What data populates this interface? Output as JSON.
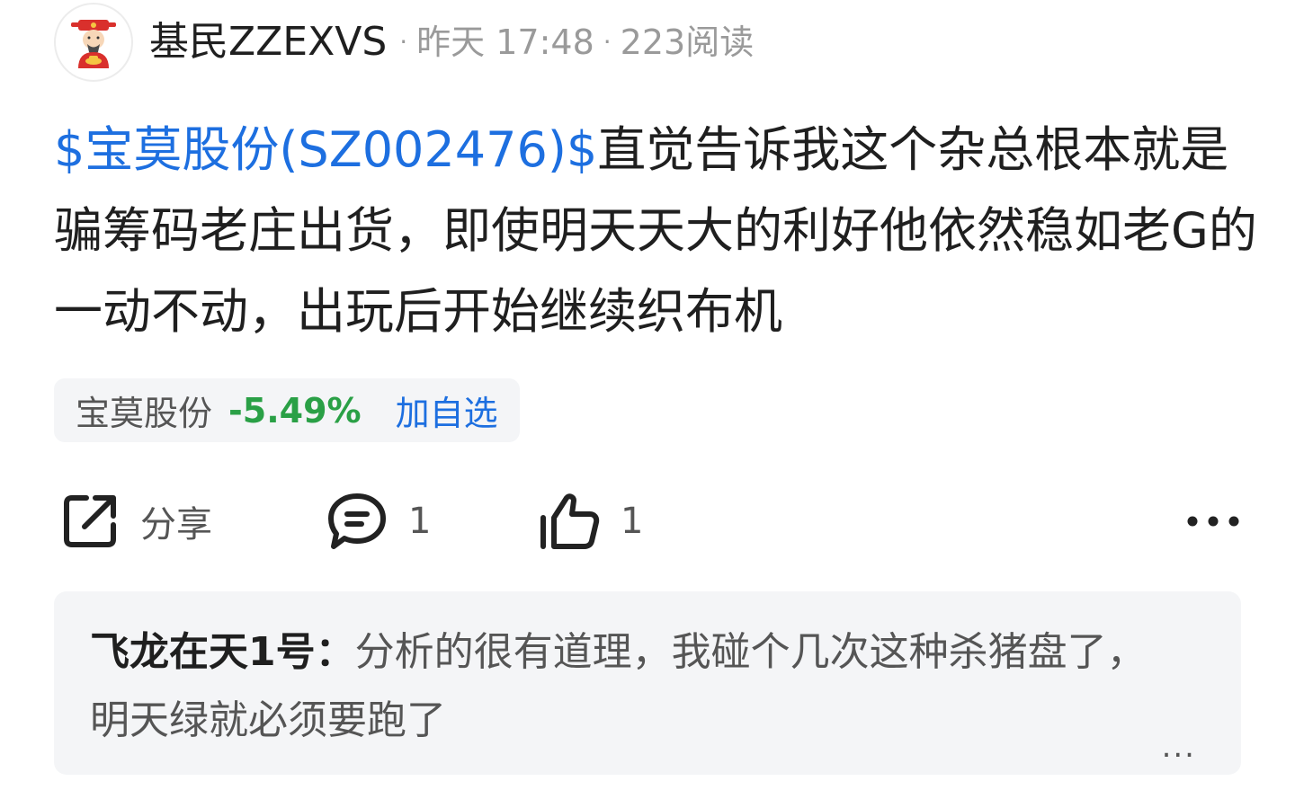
{
  "header": {
    "username": "基民ZZEXVS",
    "separator": "·",
    "time": "昨天 17:48",
    "reads": "223阅读",
    "avatar_icon": "god-of-wealth-avatar-icon"
  },
  "post": {
    "stock_tag": "$宝莫股份(SZ002476)$",
    "text": "直觉告诉我这个杂总根本就是骗筹码老庄出货，即使明天天大的利好他依然稳如老G的一动不动，出玩后开始继续织布机"
  },
  "stock_chip": {
    "name": "宝莫股份",
    "change": "-5.49%",
    "add_label": "加自选"
  },
  "actions": {
    "share_label": "分享",
    "comment_count": "1",
    "like_count": "1",
    "more_icon": "more-dots-icon"
  },
  "comment_preview": {
    "author": "飞龙在天1号",
    "colon": "：",
    "text": "分析的很有道理，我碰个几次这种杀猪盘了，明天绿就必须要跑了",
    "more": "..."
  },
  "colors": {
    "link_blue": "#1d6fe0",
    "down_green": "#2aa046",
    "chip_bg": "#f4f5f7"
  }
}
